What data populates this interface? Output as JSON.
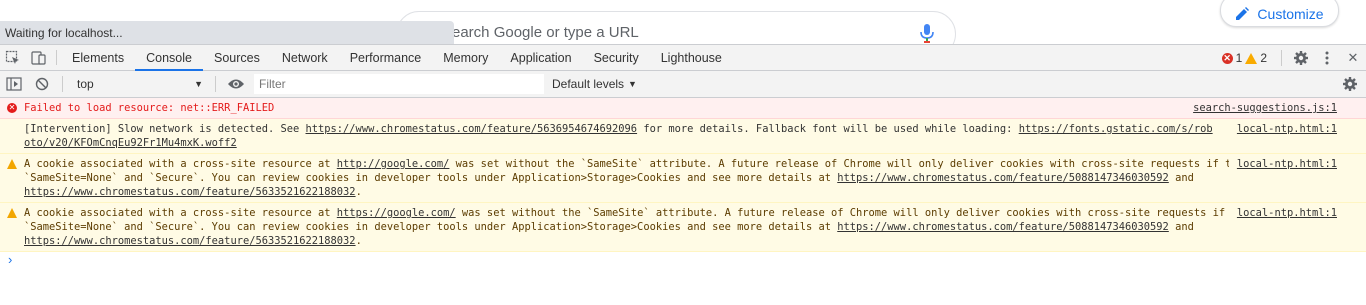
{
  "page": {
    "omnibox_placeholder": "earch Google or type a URL",
    "customize_label": "Customize",
    "status_text": "Waiting for localhost..."
  },
  "devtools": {
    "tabs": [
      {
        "label": "Elements"
      },
      {
        "label": "Console"
      },
      {
        "label": "Sources"
      },
      {
        "label": "Network"
      },
      {
        "label": "Performance"
      },
      {
        "label": "Memory"
      },
      {
        "label": "Application"
      },
      {
        "label": "Security"
      },
      {
        "label": "Lighthouse"
      }
    ],
    "active_tab": "Console",
    "error_count": "1",
    "warning_count": "2",
    "close_label": "✕"
  },
  "console_toolbar": {
    "context": "top",
    "filter_placeholder": "Filter",
    "levels_label": "Default levels"
  },
  "messages": [
    {
      "type": "error",
      "text": "Failed to load resource: net::ERR_FAILED",
      "source": "search-suggestions.js:1"
    },
    {
      "type": "info",
      "pre": "[Intervention] Slow network is detected. See ",
      "link1": "https://www.chromestatus.com/feature/5636954674692096",
      "mid": " for more details. Fallback font will be used while loading: ",
      "link2": "https://fonts.gstatic.com/s/roboto/v20/KFOmCnqEu92Fr1Mu4mxK.woff2",
      "source": "local-ntp.html:1"
    },
    {
      "type": "warn",
      "pre": "A cookie associated with a cross-site resource at ",
      "link1": "http://google.com/",
      "mid": " was set without the `SameSite` attribute. A future release of Chrome will only deliver cookies with cross-site requests if they are set with `SameSite=None` and `Secure`. You can review cookies in developer tools under Application>Storage>Cookies and see more details at ",
      "link2": "https://www.chromestatus.com/feature/5088147346030592",
      "and": " and ",
      "link3": "https://www.chromestatus.com/feature/5633521622188032",
      "end": ".",
      "source": "local-ntp.html:1"
    },
    {
      "type": "warn",
      "pre": "A cookie associated with a cross-site resource at ",
      "link1": "https://google.com/",
      "mid": " was set without the `SameSite` attribute. A future release of Chrome will only deliver cookies with cross-site requests if they are set with `SameSite=None` and `Secure`. You can review cookies in developer tools under Application>Storage>Cookies and see more details at ",
      "link2": "https://www.chromestatus.com/feature/5088147346030592",
      "and": " and ",
      "link3": "https://www.chromestatus.com/feature/5633521622188032",
      "end": ".",
      "source": "local-ntp.html:1"
    }
  ],
  "prompt_symbol": "›",
  "colors": {
    "accent": "#1a73e8",
    "error": "#e41b1b",
    "warning": "#f2a600"
  }
}
